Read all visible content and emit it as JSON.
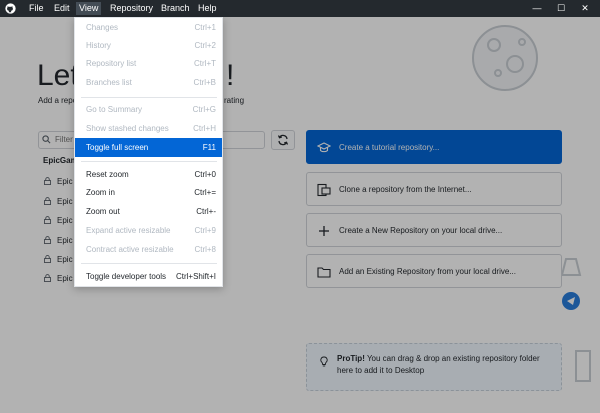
{
  "menubar": {
    "items": [
      "File",
      "Edit",
      "View",
      "Repository",
      "Branch",
      "Help"
    ],
    "active": "View",
    "window_controls": [
      "—",
      "☐",
      "✕"
    ]
  },
  "welcome": {
    "title_visible": "Let",
    "title_end": "!",
    "subtitle_start": "Add a repo",
    "subtitle_end": "rating"
  },
  "filter": {
    "placeholder": "Filter"
  },
  "repo_list": {
    "org_partial": "EpicGam",
    "repos_partial": [
      "Epic",
      "Epic",
      "Epic",
      "Epic",
      "Epic",
      "Epic"
    ]
  },
  "actions": [
    {
      "label": "Create a tutorial repository...",
      "icon": "graduation-cap-icon"
    },
    {
      "label": "Clone a repository from the Internet...",
      "icon": "device-desktop-icon"
    },
    {
      "label": "Create a New Repository on your local drive...",
      "icon": "plus-icon"
    },
    {
      "label": "Add an Existing Repository from your local drive...",
      "icon": "folder-icon"
    }
  ],
  "protip": {
    "bold": "ProTip!",
    "text": " You can drag & drop an existing repository folder here to add it to Desktop"
  },
  "view_menu": [
    {
      "label": "Changes",
      "shortcut": "Ctrl+1",
      "disabled": true
    },
    {
      "label": "History",
      "shortcut": "Ctrl+2",
      "disabled": true
    },
    {
      "label": "Repository list",
      "shortcut": "Ctrl+T",
      "disabled": true
    },
    {
      "label": "Branches list",
      "shortcut": "Ctrl+B",
      "disabled": true
    },
    {
      "label": "Go to Summary",
      "shortcut": "Ctrl+G",
      "disabled": true
    },
    {
      "label": "Show stashed changes",
      "shortcut": "Ctrl+H",
      "disabled": true
    },
    {
      "label": "Toggle full screen",
      "shortcut": "F11",
      "disabled": false,
      "selected": true
    },
    {
      "label": "Reset zoom",
      "shortcut": "Ctrl+0",
      "disabled": false
    },
    {
      "label": "Zoom in",
      "shortcut": "Ctrl+=",
      "disabled": false
    },
    {
      "label": "Zoom out",
      "shortcut": "Ctrl+-",
      "disabled": false
    },
    {
      "label": "Expand active resizable",
      "shortcut": "Ctrl+9",
      "disabled": true
    },
    {
      "label": "Contract active resizable",
      "shortcut": "Ctrl+8",
      "disabled": true
    },
    {
      "label": "Toggle developer tools",
      "shortcut": "Ctrl+Shift+I",
      "disabled": false
    }
  ],
  "colors": {
    "accent": "#0366d6",
    "titlebar": "#24292e"
  }
}
